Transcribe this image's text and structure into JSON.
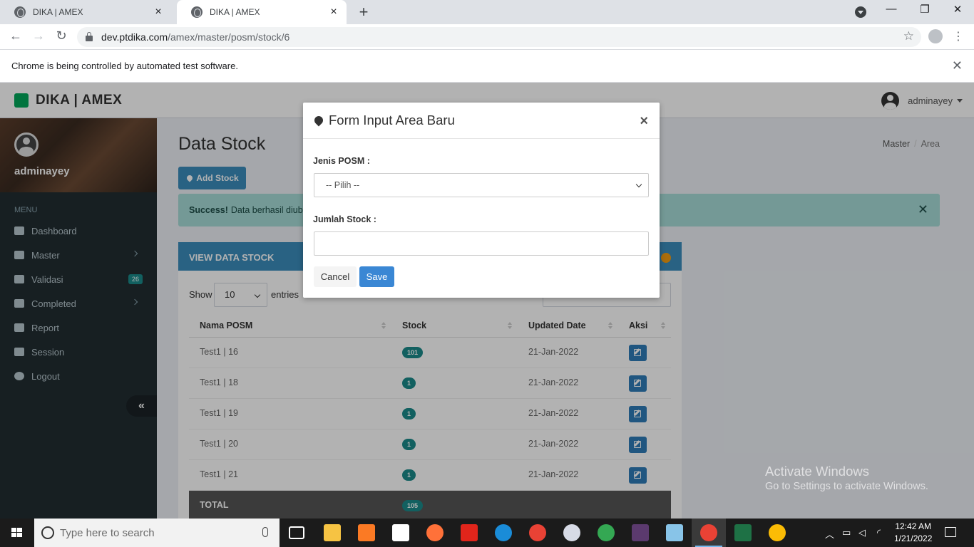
{
  "browser": {
    "tabs": [
      {
        "title": "DIKA | AMEX"
      },
      {
        "title": "DIKA | AMEX"
      }
    ],
    "url_host": "dev.ptdika.com",
    "url_path": "/amex/master/posm/stock/6",
    "infobar_text": "Chrome is being controlled by automated test software."
  },
  "app": {
    "brand": "DIKA | AMEX",
    "user": "adminayey",
    "sidebar": {
      "username": "adminayey",
      "menu_header": "MENU",
      "items": [
        {
          "label": "Dashboard",
          "icon": "dashboard-icon"
        },
        {
          "label": "Master",
          "icon": "folder-icon"
        },
        {
          "label": "Validasi",
          "icon": "shield-icon",
          "badge": "26"
        },
        {
          "label": "Completed",
          "icon": "table-icon"
        },
        {
          "label": "Report",
          "icon": "calendar-icon"
        },
        {
          "label": "Session",
          "icon": "calendar-icon"
        },
        {
          "label": "Logout",
          "icon": "power-icon"
        }
      ],
      "collapse_glyph": "«"
    },
    "page_title": "Data Stock",
    "breadcrumb": [
      "Master",
      "Area"
    ],
    "add_button": "Add Stock",
    "alert": {
      "strong": "Success!",
      "text": "Data berhasil diuba"
    },
    "box_title": "VIEW DATA STOCK",
    "show_label": "Show",
    "page_length": "10",
    "entries_label": "entries",
    "table": {
      "headers": [
        "Nama POSM",
        "Stock",
        "Updated Date",
        "Aksi"
      ],
      "rows": [
        {
          "nama": "Test1 | 16",
          "stock": "101",
          "date": "21-Jan-2022"
        },
        {
          "nama": "Test1 | 18",
          "stock": "1",
          "date": "21-Jan-2022"
        },
        {
          "nama": "Test1 | 19",
          "stock": "1",
          "date": "21-Jan-2022"
        },
        {
          "nama": "Test1 | 20",
          "stock": "1",
          "date": "21-Jan-2022"
        },
        {
          "nama": "Test1 | 21",
          "stock": "1",
          "date": "21-Jan-2022"
        }
      ],
      "total_label": "TOTAL",
      "total_value": "105"
    }
  },
  "modal": {
    "title": "Form Input Area Baru",
    "close_glyph": "×",
    "jenis_label": "Jenis POSM :",
    "jenis_selected": "-- Pilih --",
    "jumlah_label": "Jumlah Stock :",
    "jumlah_value": "",
    "cancel": "Cancel",
    "save": "Save"
  },
  "watermark": {
    "title": "Activate Windows",
    "subtitle": "Go to Settings to activate Windows."
  },
  "taskbar": {
    "search_placeholder": "Type here to search",
    "time": "12:42 AM",
    "date": "1/21/2022"
  },
  "colors": {
    "primary": "#3c8dbc",
    "sidebar": "#222d32",
    "badge": "#1a8a8a",
    "alert": "#a6dbd7"
  }
}
